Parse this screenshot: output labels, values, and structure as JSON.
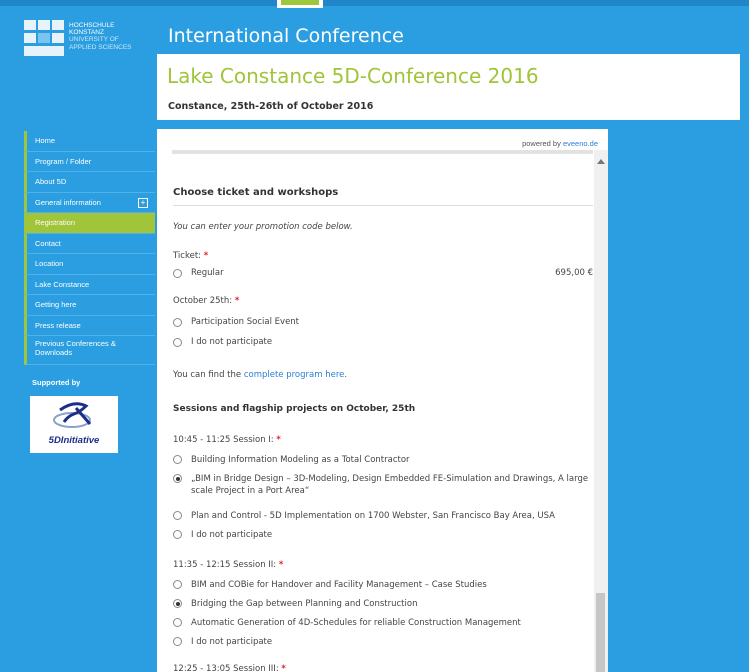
{
  "colors": {
    "page_bg": "#2a9ee0",
    "accent_green": "#a0c43a",
    "required": "#e0202a",
    "link": "#2a7fd4"
  },
  "logo": {
    "line1": "HOCHSCHULE",
    "line2": "KONSTANZ",
    "line3": "UNIVERSITY OF",
    "line4": "APPLIED SCIENCES"
  },
  "site_title": "International Conference",
  "conference": {
    "title": "Lake Constance 5D-Conference 2016",
    "subtitle": "Constance, 25th-26th of October 2016"
  },
  "nav": {
    "items": [
      {
        "label": "Home"
      },
      {
        "label": "Program / Folder"
      },
      {
        "label": "About 5D"
      },
      {
        "label": "General information",
        "icon": "plus-box-icon"
      },
      {
        "label": "Registration",
        "active": true
      },
      {
        "label": "Contact"
      },
      {
        "label": "Location"
      },
      {
        "label": "Lake Constance"
      },
      {
        "label": "Getting here"
      },
      {
        "label": "Press release"
      },
      {
        "label": "Previous Conferences & Downloads"
      }
    ],
    "supported_by": "Supported by",
    "sponsor": {
      "text": "5DInitiative",
      "icon": "5d-initiative-logo"
    }
  },
  "form": {
    "powered_by": "powered by",
    "powered_link": "eveeno.de",
    "section_title": "Choose ticket and workshops",
    "promo_text": "You can enter your promotion code below.",
    "ticket": {
      "label": "Ticket:",
      "required_mark": "*",
      "options": [
        {
          "label": "Regular",
          "price": "695,00 €",
          "checked": false
        }
      ]
    },
    "oct25": {
      "label": "October 25th:",
      "required_mark": "*",
      "options": [
        {
          "label": "Participation Social Event",
          "checked": false
        },
        {
          "label": "I do not participate",
          "checked": false
        }
      ]
    },
    "program_text": "You can find the",
    "program_link": "complete program here",
    "program_end": ".",
    "sessions_title": "Sessions and flagship projects on October, 25th",
    "session1": {
      "label": "10:45 - 11:25 Session I:",
      "required_mark": "*",
      "options": [
        {
          "label": "Building Information Modeling as a Total Contractor",
          "checked": false
        },
        {
          "label": "„BIM in Bridge Design – 3D-Modeling, Design Embedded FE-Simulation and Drawings, A large scale Project in a Port Area“",
          "checked": true
        },
        {
          "label": "Plan and Control - 5D Implementation on 1700 Webster, San Francisco Bay Area, USA",
          "checked": false
        },
        {
          "label": "I do not participate",
          "checked": false
        }
      ]
    },
    "session2": {
      "label": "11:35 - 12:15 Session II:",
      "required_mark": "*",
      "options": [
        {
          "label": "BIM and COBie for Handover and Facility Management – Case Studies",
          "checked": false
        },
        {
          "label": "Bridging the Gap between Planning and Construction",
          "checked": true
        },
        {
          "label": "Automatic Generation of 4D-Schedules for reliable Construction Management",
          "checked": false
        },
        {
          "label": "I do not participate",
          "checked": false
        }
      ]
    },
    "session3": {
      "label": "12:25 - 13:05 Session III:",
      "required_mark": "*"
    }
  }
}
